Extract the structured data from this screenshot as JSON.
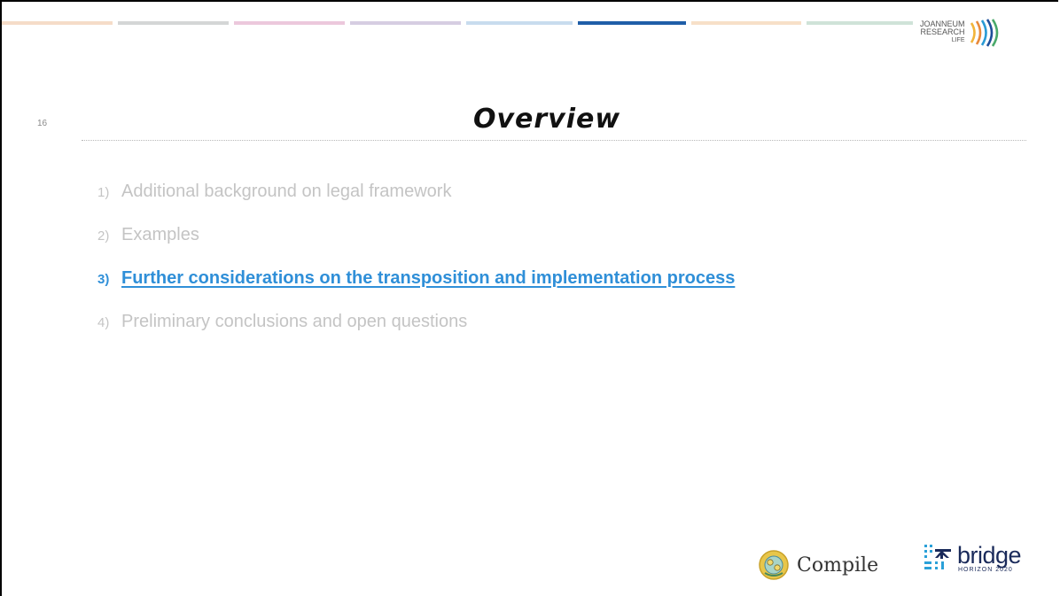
{
  "slide": {
    "number": "16",
    "title": "Overview"
  },
  "colors": {
    "segments": [
      "#f5dcc8",
      "#d4d6d6",
      "#ecc8dc",
      "#d6cde2",
      "#c8dcee",
      "#1f5ea8",
      "#f7e0c8",
      "#cfe3d8"
    ],
    "active_text": "#2f8fd8",
    "inactive_text": "#c4c4c4"
  },
  "agenda": [
    {
      "num": "1)",
      "text": "Additional background on legal framework",
      "active": false
    },
    {
      "num": "2)",
      "text": "Examples",
      "active": false
    },
    {
      "num": "3)",
      "text": "Further considerations on the transposition and implementation process",
      "active": true
    },
    {
      "num": "4)",
      "text": "Preliminary conclusions and open questions",
      "active": false
    }
  ],
  "logos": {
    "joanneum": {
      "line1": "JOANNEUM",
      "line2": "RESEARCH",
      "line3": "LIFE"
    },
    "compile": "Compile",
    "bridge": {
      "name": "bridge",
      "tagline": "HORIZON 2020"
    }
  }
}
